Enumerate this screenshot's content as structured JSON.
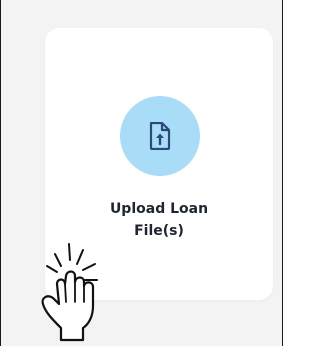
{
  "upload_card": {
    "title_line1": "Upload Loan",
    "title_line2": "File(s)",
    "icon": "file-upload-icon",
    "icon_circle_color": "#a9dcf6",
    "icon_color": "#2b4a7a"
  },
  "overlay": {
    "pointer": "hand-click-icon"
  }
}
